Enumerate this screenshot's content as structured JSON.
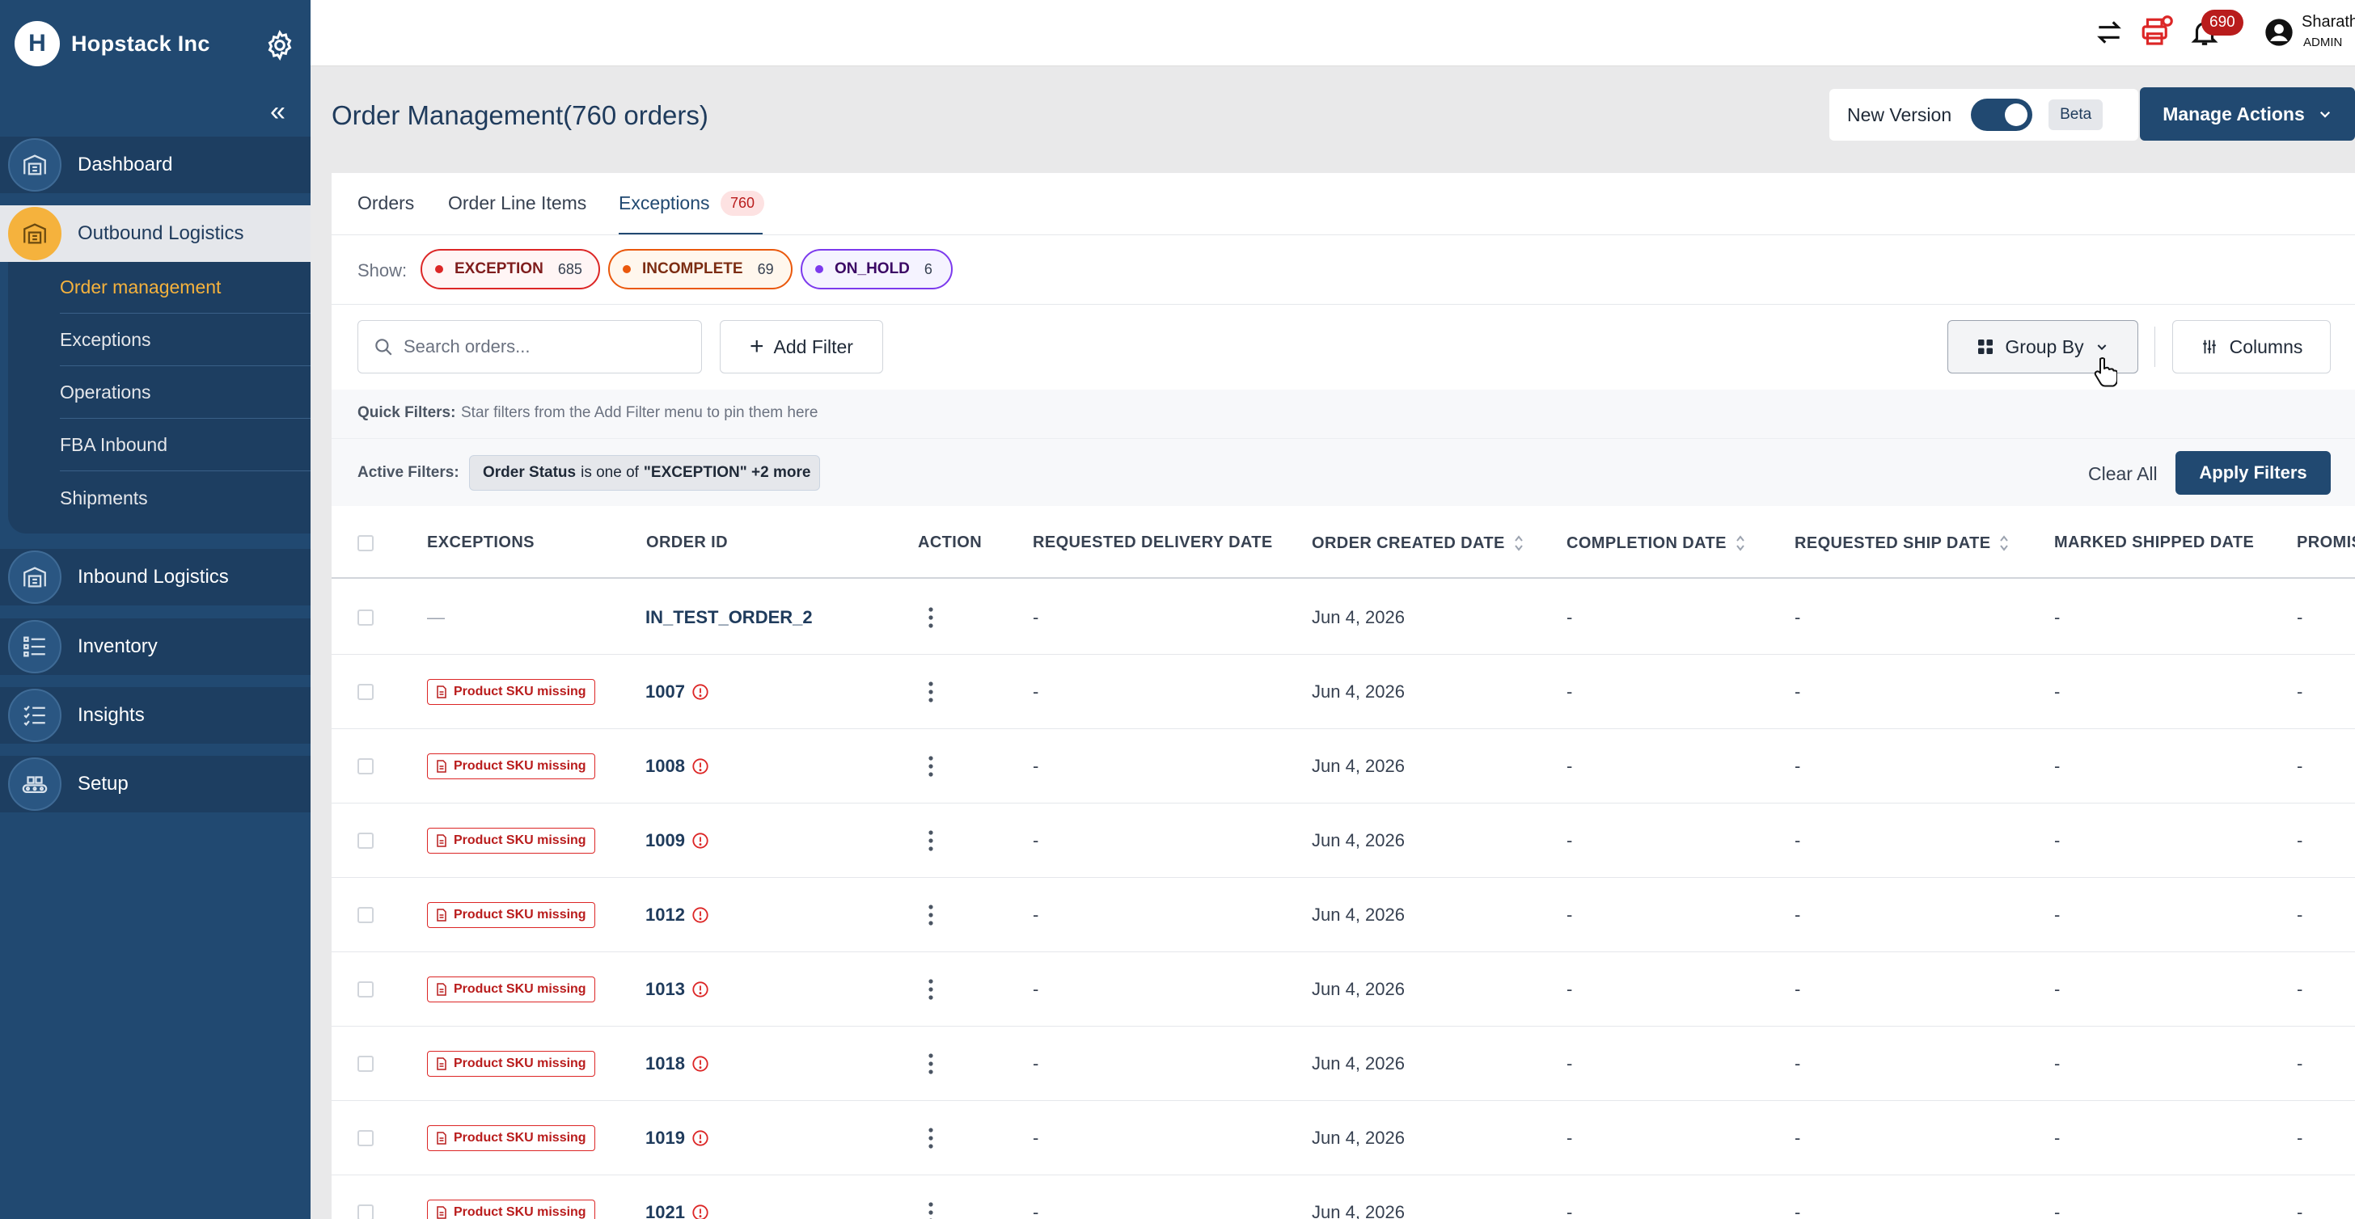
{
  "brand": {
    "name": "Hopstack Inc",
    "logo_letter": "H"
  },
  "sidebar": {
    "collapse_icon": "«",
    "items": [
      {
        "label": "Dashboard",
        "icon": "warehouse-icon"
      },
      {
        "label": "Outbound Logistics",
        "icon": "warehouse-icon",
        "active": true
      },
      {
        "label": "Inbound Logistics",
        "icon": "warehouse-icon"
      },
      {
        "label": "Inventory",
        "icon": "list-icon"
      },
      {
        "label": "Insights",
        "icon": "checklist-icon"
      },
      {
        "label": "Setup",
        "icon": "setup-icon"
      }
    ],
    "subitems": [
      {
        "label": "Order management",
        "active": true
      },
      {
        "label": "Exceptions"
      },
      {
        "label": "Operations"
      },
      {
        "label": "FBA Inbound"
      },
      {
        "label": "Shipments"
      }
    ]
  },
  "topbar": {
    "notifications_count": "690",
    "user_name": "Sharath",
    "user_role": "ADMIN"
  },
  "header": {
    "title": "Order Management(760 orders)",
    "new_version_label": "New Version",
    "new_version_on": true,
    "beta_label": "Beta",
    "manage_actions_label": "Manage Actions"
  },
  "tabs": [
    {
      "label": "Orders"
    },
    {
      "label": "Order Line Items"
    },
    {
      "label": "Exceptions",
      "badge": "760",
      "active": true
    }
  ],
  "filters": {
    "show_label": "Show:",
    "chips": [
      {
        "label": "EXCEPTION",
        "count": "685",
        "color": "#dc2626"
      },
      {
        "label": "INCOMPLETE",
        "count": "69",
        "color": "#ea580c"
      },
      {
        "label": "ON_HOLD",
        "count": "6",
        "color": "#7c3aed"
      }
    ],
    "search_placeholder": "Search orders...",
    "add_filter_label": "Add Filter",
    "group_by_label": "Group By",
    "columns_label": "Columns",
    "quick_filters_label": "Quick Filters:",
    "quick_filters_text": "Star filters from the Add Filter menu to pin them here",
    "active_filters_label": "Active Filters:",
    "active_filter": {
      "field": "Order Status",
      "op": "is one of",
      "value": "\"EXCEPTION\" +2 more"
    },
    "clear_all_label": "Clear All",
    "apply_label": "Apply Filters"
  },
  "table": {
    "columns": [
      "EXCEPTIONS",
      "ORDER ID",
      "ACTION",
      "REQUESTED DELIVERY DATE",
      "ORDER CREATED DATE",
      "COMPLETION DATE",
      "REQUESTED SHIP DATE",
      "MARKED SHIPPED DATE",
      "PROMIS"
    ],
    "rows": [
      {
        "exception": "—",
        "order_id": "IN_TEST_ORDER_2",
        "has_warning": false,
        "req_delivery": "-",
        "created": "Jun 4, 2026",
        "completion": "-",
        "req_ship": "-",
        "marked_shipped": "-",
        "promise": "-"
      },
      {
        "exception": "Product SKU missing",
        "order_id": "1007",
        "has_warning": true,
        "req_delivery": "-",
        "created": "Jun 4, 2026",
        "completion": "-",
        "req_ship": "-",
        "marked_shipped": "-",
        "promise": "-"
      },
      {
        "exception": "Product SKU missing",
        "order_id": "1008",
        "has_warning": true,
        "req_delivery": "-",
        "created": "Jun 4, 2026",
        "completion": "-",
        "req_ship": "-",
        "marked_shipped": "-",
        "promise": "-"
      },
      {
        "exception": "Product SKU missing",
        "order_id": "1009",
        "has_warning": true,
        "req_delivery": "-",
        "created": "Jun 4, 2026",
        "completion": "-",
        "req_ship": "-",
        "marked_shipped": "-",
        "promise": "-"
      },
      {
        "exception": "Product SKU missing",
        "order_id": "1012",
        "has_warning": true,
        "req_delivery": "-",
        "created": "Jun 4, 2026",
        "completion": "-",
        "req_ship": "-",
        "marked_shipped": "-",
        "promise": "-"
      },
      {
        "exception": "Product SKU missing",
        "order_id": "1013",
        "has_warning": true,
        "req_delivery": "-",
        "created": "Jun 4, 2026",
        "completion": "-",
        "req_ship": "-",
        "marked_shipped": "-",
        "promise": "-"
      },
      {
        "exception": "Product SKU missing",
        "order_id": "1018",
        "has_warning": true,
        "req_delivery": "-",
        "created": "Jun 4, 2026",
        "completion": "-",
        "req_ship": "-",
        "marked_shipped": "-",
        "promise": "-"
      },
      {
        "exception": "Product SKU missing",
        "order_id": "1019",
        "has_warning": true,
        "req_delivery": "-",
        "created": "Jun 4, 2026",
        "completion": "-",
        "req_ship": "-",
        "marked_shipped": "-",
        "promise": "-"
      },
      {
        "exception": "Product SKU missing",
        "order_id": "1021",
        "has_warning": true,
        "req_delivery": "-",
        "created": "Jun 4, 2026",
        "completion": "-",
        "req_ship": "-",
        "marked_shipped": "-",
        "promise": "-"
      }
    ]
  },
  "colors": {
    "sidebar": "#214971",
    "accent": "#f5b23d",
    "primary": "#214971",
    "danger": "#b91c1c"
  }
}
